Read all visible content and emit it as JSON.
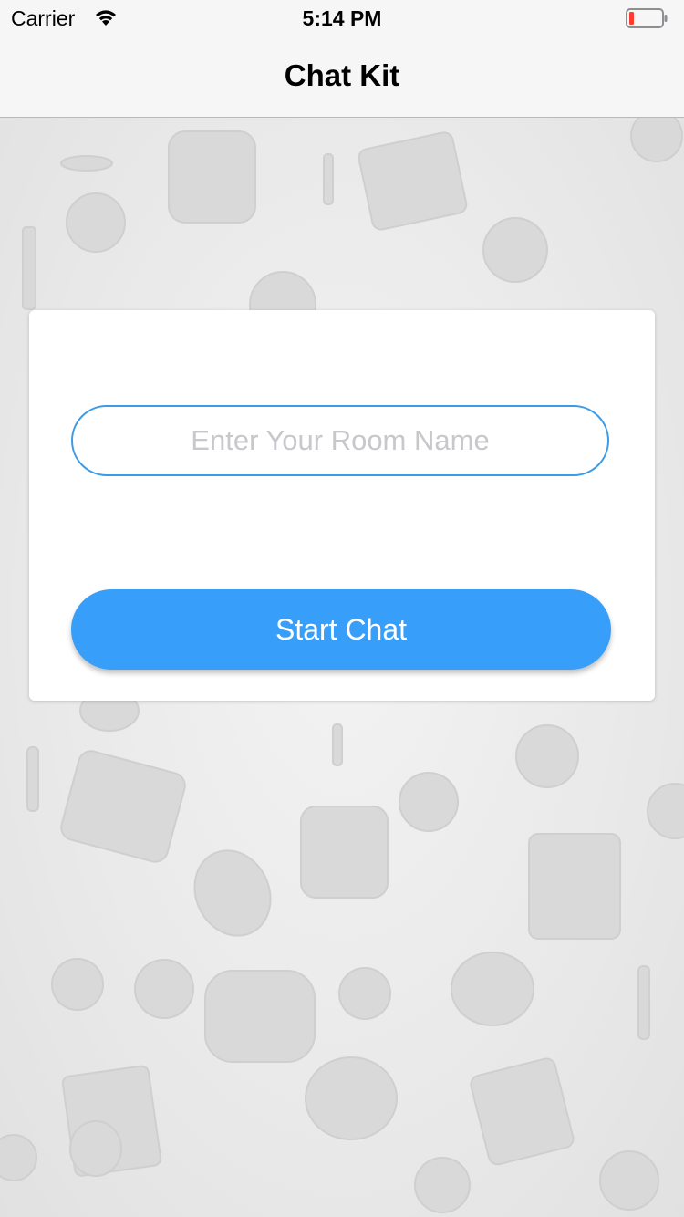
{
  "status_bar": {
    "carrier": "Carrier",
    "time": "5:14 PM",
    "wifi_icon": "wifi-icon",
    "battery_icon": "battery-icon",
    "battery_color": "#ff3b30"
  },
  "nav": {
    "title": "Chat Kit"
  },
  "background": {
    "pattern": "food-doodle-pattern"
  },
  "form": {
    "room_input": {
      "value": "",
      "placeholder": "Enter Your Room Name"
    },
    "start_button_label": "Start Chat",
    "accent_color": "#379ff9",
    "input_border_color": "#3a9be8"
  }
}
